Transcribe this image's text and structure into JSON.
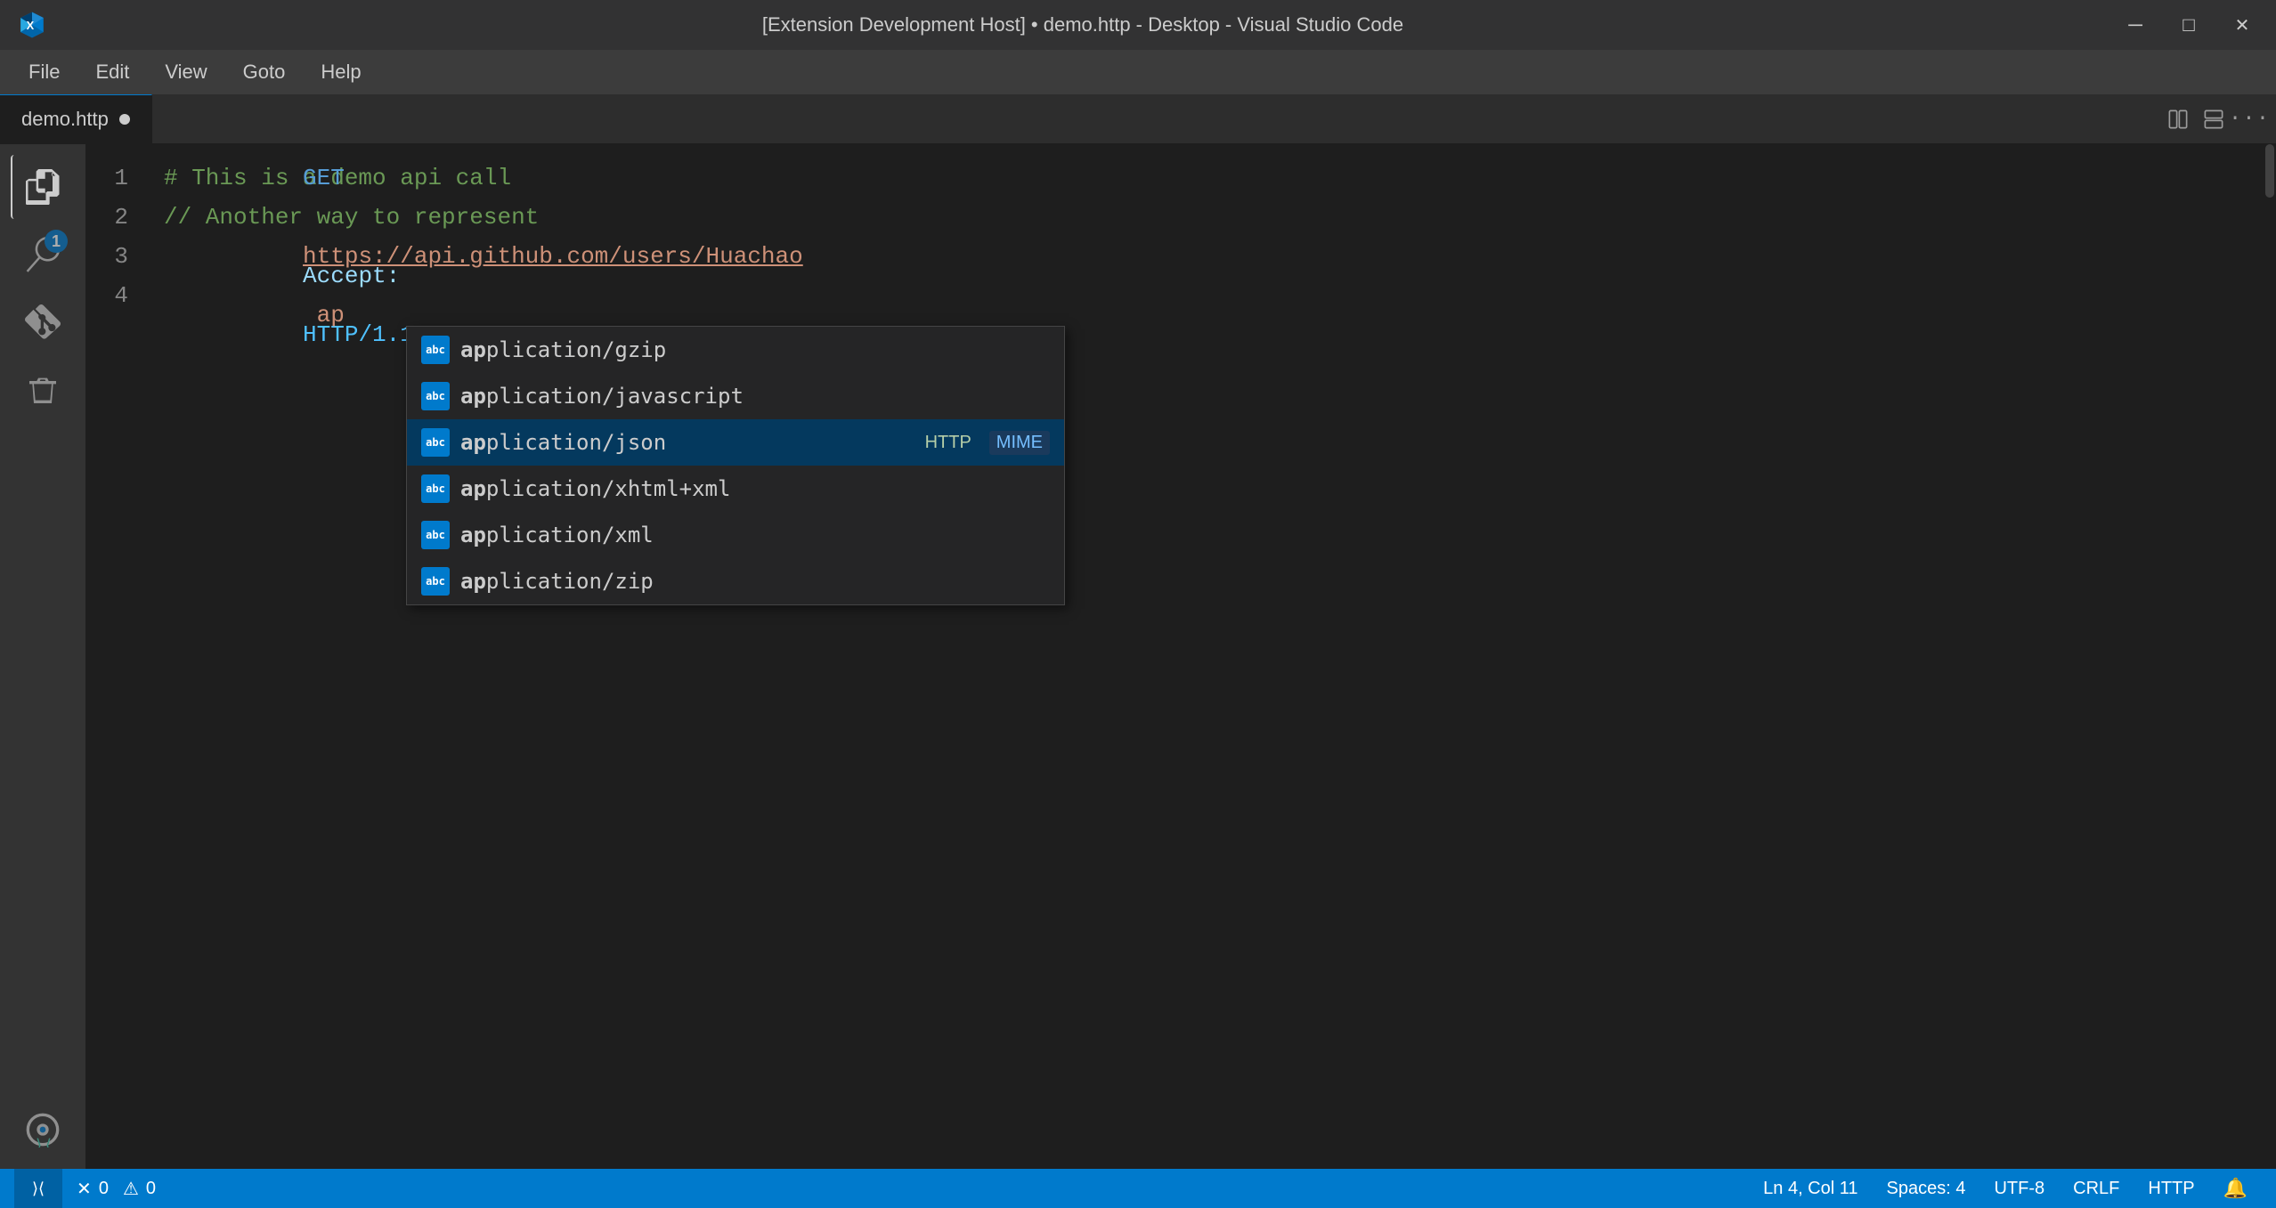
{
  "titlebar": {
    "title": "[Extension Development Host] • demo.http - Desktop - Visual Studio Code",
    "minimize": "─",
    "maximize": "□",
    "close": "✕"
  },
  "menubar": {
    "items": [
      "File",
      "Edit",
      "View",
      "Goto",
      "Help"
    ]
  },
  "tab": {
    "filename": "demo.http",
    "modified": true
  },
  "code": {
    "lines": [
      {
        "num": "1",
        "type": "comment",
        "content": "# This is a demo api call"
      },
      {
        "num": "2",
        "type": "comment2",
        "content": "// Another way to represent"
      },
      {
        "num": "3",
        "type": "request",
        "method": "GET",
        "url": "https://api.github.com/users/Huachao",
        "version": "HTTP/1.1"
      },
      {
        "num": "4",
        "type": "header",
        "key": "Accept:",
        "value": " ap"
      }
    ]
  },
  "autocomplete": {
    "items": [
      {
        "icon": "abc",
        "text": "application/gzip",
        "match": "ap",
        "rest": "plication/gzip",
        "type": "",
        "source": "",
        "selected": false
      },
      {
        "icon": "abc",
        "text": "application/javascript",
        "match": "ap",
        "rest": "plication/javascript",
        "type": "",
        "source": "",
        "selected": false
      },
      {
        "icon": "abc",
        "text": "application/json",
        "match": "ap",
        "rest": "plication/json",
        "type": "HTTP",
        "source": "MIME",
        "selected": true
      },
      {
        "icon": "abc",
        "text": "application/xhtml+xml",
        "match": "ap",
        "rest": "plication/xhtml+xml",
        "type": "",
        "source": "",
        "selected": false
      },
      {
        "icon": "abc",
        "text": "application/xml",
        "match": "ap",
        "rest": "plication/xml",
        "type": "",
        "source": "",
        "selected": false
      },
      {
        "icon": "abc",
        "text": "application/zip",
        "match": "ap",
        "rest": "plication/zip",
        "type": "",
        "source": "",
        "selected": false
      }
    ]
  },
  "statusbar": {
    "error_count": "0",
    "warning_count": "0",
    "position": "Ln 4, Col 11",
    "spaces": "Spaces: 4",
    "encoding": "UTF-8",
    "line_ending": "CRLF",
    "language": "HTTP",
    "remote_icon": "remote"
  },
  "activity_bar": {
    "badge": "1"
  }
}
